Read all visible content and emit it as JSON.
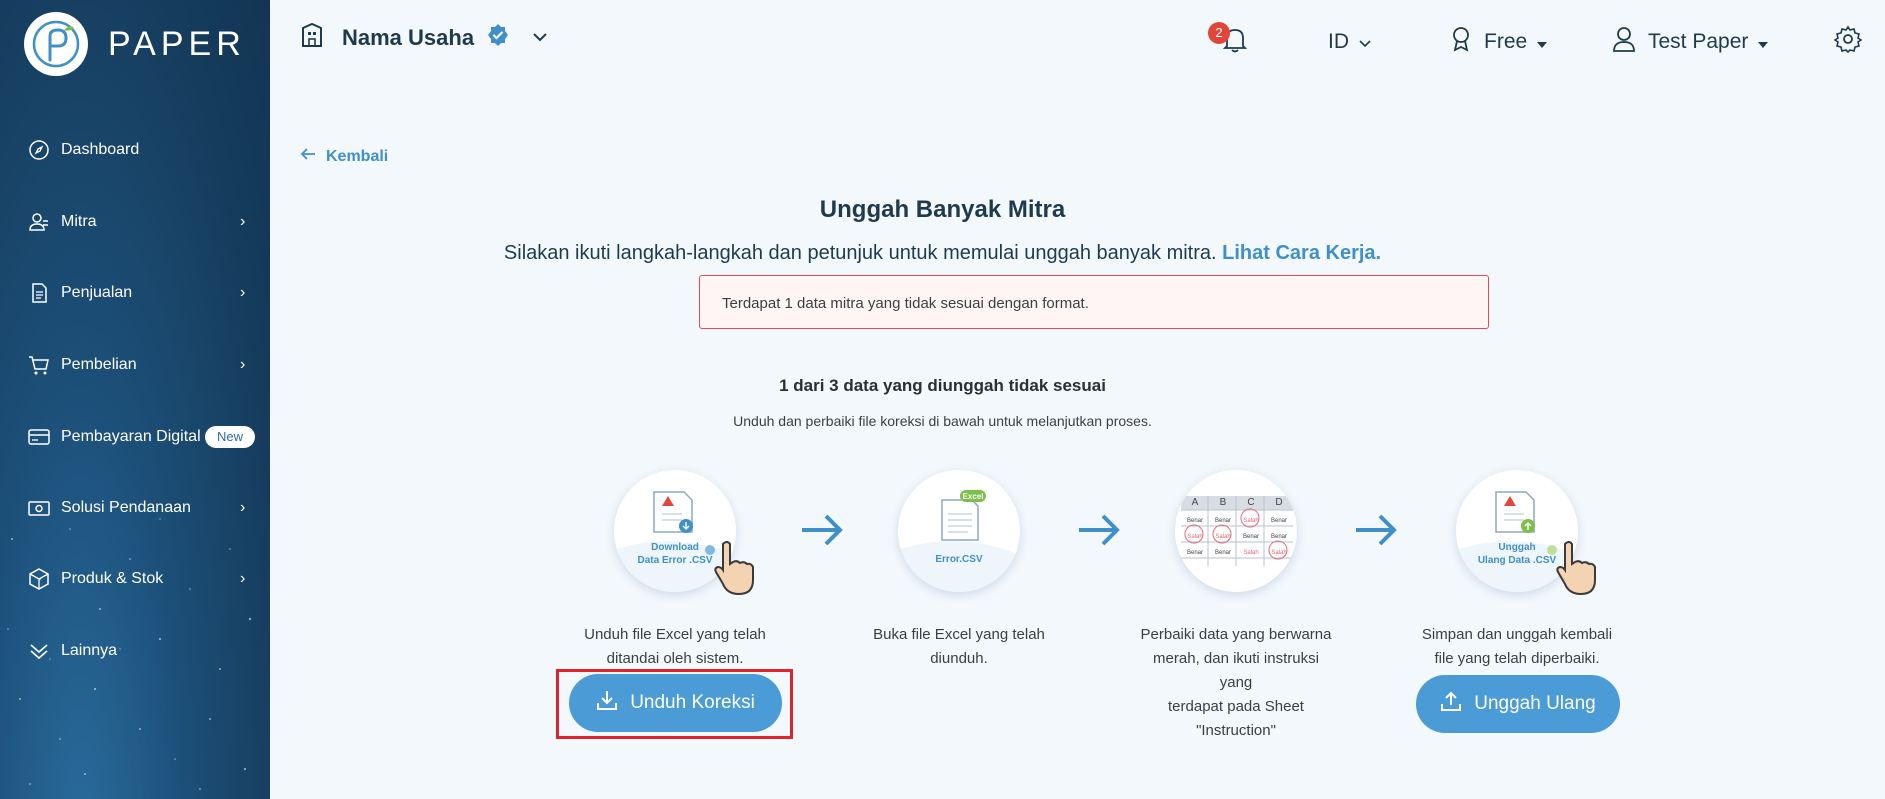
{
  "sidebar": {
    "brand": "PAPER",
    "items": [
      {
        "label": "Dashboard",
        "icon": "compass-icon",
        "has_chevron": false
      },
      {
        "label": "Mitra",
        "icon": "users-icon",
        "has_chevron": true
      },
      {
        "label": "Penjualan",
        "icon": "document-icon",
        "has_chevron": true
      },
      {
        "label": "Pembelian",
        "icon": "cart-icon",
        "has_chevron": true
      },
      {
        "label": "Pembayaran Digital",
        "icon": "card-icon",
        "has_chevron": false,
        "badge": "New"
      },
      {
        "label": "Solusi Pendanaan",
        "icon": "money-icon",
        "has_chevron": true
      },
      {
        "label": "Produk & Stok",
        "icon": "box-icon",
        "has_chevron": true
      },
      {
        "label": "Lainnya",
        "icon": "double-chevron-down-icon",
        "has_chevron": false
      }
    ]
  },
  "header": {
    "business_name": "Nama Usaha",
    "notification_count": "2",
    "language": "ID",
    "plan": "Free",
    "user": "Test Paper"
  },
  "main": {
    "back_label": "Kembali",
    "title": "Unggah Banyak Mitra",
    "subtitle": "Silakan ikuti langkah-langkah dan petunjuk untuk memulai unggah banyak mitra.",
    "subtitle_link": "Lihat Cara Kerja.",
    "alert": "Terdapat 1 data mitra yang tidak sesuai dengan format.",
    "count_text": "1 dari 3 data yang diunggah tidak sesuai",
    "hint_text": "Unduh dan perbaiki file koreksi di bawah untuk melanjutkan proses.",
    "steps": [
      {
        "text_1": "Unduh file Excel yang telah",
        "text_2": "ditandai oleh sistem.",
        "image_caption_1": "Download",
        "image_caption_2": "Data Error .CSV"
      },
      {
        "text_1": "Buka file Excel yang telah",
        "text_2": "diunduh.",
        "image_caption": "Error.CSV",
        "tag": "Excel"
      },
      {
        "text_1": "Perbaiki data yang berwarna",
        "text_2": "merah, dan ikuti instruksi yang",
        "text_3": "terdapat pada Sheet",
        "text_4": "\"Instruction\"",
        "columns": [
          "A",
          "B",
          "C",
          "D"
        ],
        "cell_ok": "Benar",
        "cell_bad": "Salah"
      },
      {
        "text_1": "Simpan dan unggah kembali",
        "text_2": "file yang telah diperbaiki.",
        "image_caption_1": "Unggah",
        "image_caption_2": "Ulang Data .CSV"
      }
    ],
    "download_button": "Unduh Koreksi",
    "reupload_button": "Unggah Ulang"
  },
  "colors": {
    "accent": "#4a9bd6",
    "sidebar": "#163d5e",
    "alert_border": "#e34a5c",
    "highlight": "#e0222a"
  }
}
